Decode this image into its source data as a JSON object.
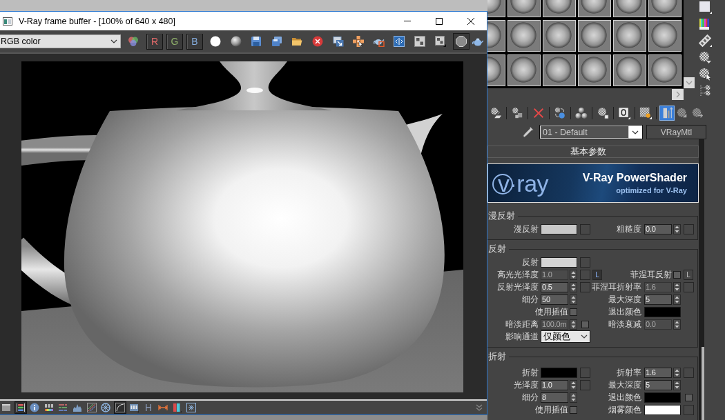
{
  "vfb": {
    "title": "V-Ray frame buffer - [100% of 640 x 480]",
    "channel_dropdown": "RGB color",
    "channels": [
      {
        "label": "R",
        "on": true,
        "color": "#e86b6b"
      },
      {
        "label": "G",
        "on": true,
        "color": "#8fb06a"
      },
      {
        "label": "B",
        "on": true,
        "color": "#86aee0"
      }
    ],
    "bottom_tools": [
      {
        "kind": "window",
        "on": false
      },
      {
        "kind": "layers",
        "on": true
      },
      {
        "kind": "info",
        "on": false
      },
      {
        "kind": "hsl",
        "on": false
      },
      {
        "kind": "levels",
        "on": false
      },
      {
        "kind": "histogram",
        "on": false
      },
      {
        "kind": "stripes",
        "on": false
      },
      {
        "kind": "wheel",
        "on": false
      },
      {
        "kind": "curve",
        "on": true
      },
      {
        "kind": "lut",
        "on": false
      },
      {
        "kind": "letter",
        "label": "H",
        "on": false
      },
      {
        "kind": "arrows",
        "on": false
      },
      {
        "kind": "bars",
        "on": false
      },
      {
        "kind": "star",
        "on": false
      }
    ]
  },
  "material_editor": {
    "toolbar_groups": [
      [
        {
          "kind": "assign",
          "on": false
        }
      ],
      [
        {
          "kind": "reset",
          "on": false
        }
      ],
      [
        {
          "kind": "delete",
          "on": false
        }
      ],
      [
        {
          "kind": "copy",
          "on": false
        }
      ],
      [
        {
          "kind": "unique",
          "on": false
        }
      ],
      [
        {
          "kind": "library",
          "on": false
        }
      ],
      [
        {
          "kind": "channel",
          "on": false
        }
      ],
      [
        {
          "kind": "checker",
          "on": false
        }
      ],
      [
        {
          "kind": "result",
          "on": true
        },
        {
          "kind": "parent",
          "on": false
        },
        {
          "kind": "sibling",
          "on": false
        }
      ]
    ],
    "material_name": "01 - Default",
    "material_type": "VRayMtl",
    "rollout_title": "基本参数",
    "banner": {
      "logo": "v·ray",
      "title": "V-Ray PowerShader",
      "subtitle": "optimized for V-Ray"
    },
    "groups": [
      {
        "title": "漫反射",
        "rows": [
          {
            "left": {
              "kind": "color",
              "label": "漫反射",
              "color": "#c8c8c8",
              "map": true
            },
            "right": {
              "kind": "spinner",
              "label": "粗糙度",
              "value": "0.0",
              "disabled": false,
              "map": true
            }
          }
        ]
      },
      {
        "title": "反射",
        "rows": [
          {
            "left": {
              "kind": "color",
              "label": "反射",
              "color": "#d4d4d4",
              "map": true
            }
          },
          {
            "left": {
              "kind": "spinner",
              "label": "高光光泽度",
              "value": "1.0",
              "disabled": true,
              "map": true,
              "lock": {
                "label": "L",
                "on": true
              }
            },
            "right": {
              "kind": "checkbox",
              "label": "菲涅耳反射",
              "checked": false,
              "lock": {
                "label": "L",
                "on": false
              }
            }
          },
          {
            "left": {
              "kind": "spinner",
              "label": "反射光泽度",
              "value": "0.5",
              "disabled": false,
              "map": true
            },
            "right": {
              "kind": "spinner",
              "label": "菲涅耳折射率",
              "value": "1.6",
              "disabled": true,
              "map": true
            }
          },
          {
            "left": {
              "kind": "spinner",
              "label": "细分",
              "value": "50",
              "disabled": false,
              "map": false
            },
            "right": {
              "kind": "spinner",
              "label": "最大深度",
              "value": "5",
              "disabled": false,
              "map": false
            }
          },
          {
            "left": {
              "kind": "checkbox",
              "label": "使用插值",
              "checked": false
            },
            "right": {
              "kind": "color",
              "label": "退出颜色",
              "color": "#000000",
              "map": false
            }
          },
          {
            "left": {
              "kind": "spinner",
              "label": "暗淡距离",
              "value": "100.0m",
              "disabled": true,
              "map": false,
              "switch": {
                "checked": false
              }
            },
            "right": {
              "kind": "spinner",
              "label": "暗淡衰减",
              "value": "0.0",
              "disabled": true,
              "map": false
            }
          },
          {
            "left": {
              "kind": "dropdown",
              "label": "影响通道",
              "value": "仅颜色"
            }
          }
        ]
      },
      {
        "title": "折射",
        "rows": [
          {
            "left": {
              "kind": "color",
              "label": "折射",
              "color": "#000000",
              "map": true
            },
            "right": {
              "kind": "spinner",
              "label": "折射率",
              "value": "1.6",
              "disabled": false,
              "map": true
            }
          },
          {
            "left": {
              "kind": "spinner",
              "label": "光泽度",
              "value": "1.0",
              "disabled": false,
              "map": true
            },
            "right": {
              "kind": "spinner",
              "label": "最大深度",
              "value": "5",
              "disabled": false,
              "map": false
            }
          },
          {
            "left": {
              "kind": "spinner",
              "label": "细分",
              "value": "8",
              "disabled": false,
              "map": false
            },
            "right": {
              "kind": "color",
              "label": "退出颜色",
              "color": "#000000",
              "map": false,
              "switch": {
                "checked": false
              }
            }
          },
          {
            "left": {
              "kind": "checkbox",
              "label": "使用插值",
              "checked": false
            },
            "right": {
              "kind": "color",
              "label": "烟雾颜色",
              "color": "#ffffff",
              "map": true
            }
          }
        ]
      }
    ]
  }
}
